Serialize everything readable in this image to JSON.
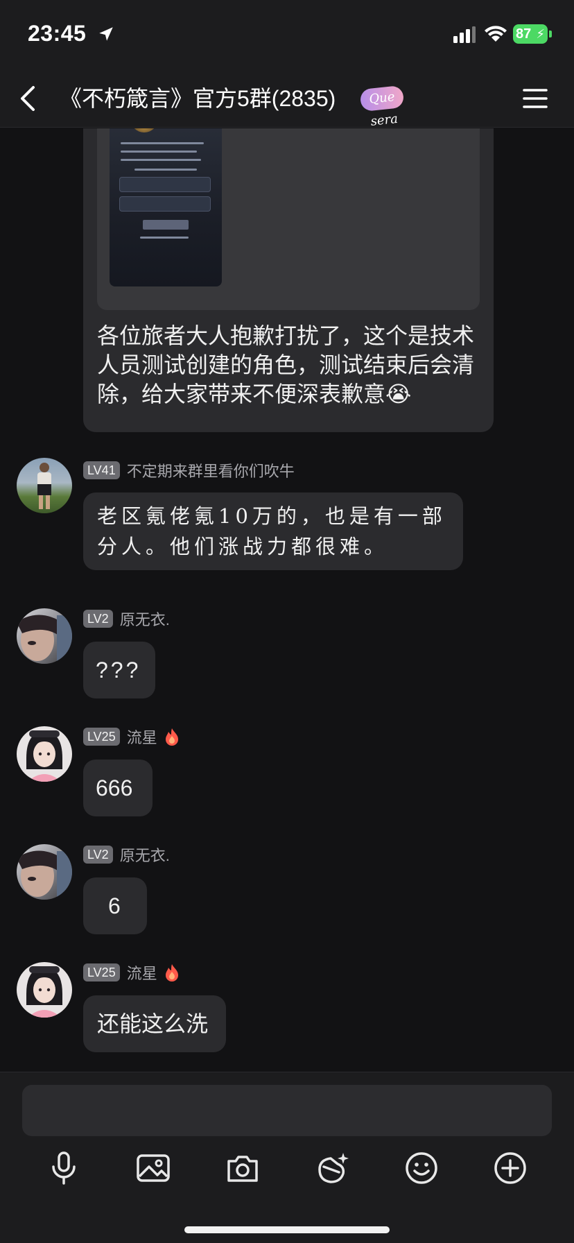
{
  "status_bar": {
    "time": "23:45",
    "battery": "87"
  },
  "header": {
    "title": "《不朽箴言》官方5群(2835)",
    "badge_text": "Que sera"
  },
  "system_message": {
    "text": "各位旅者大人抱歉打扰了，这个是技术人员测试创建的角色，测试结束后会清除，给大家带来不便深表歉意😭"
  },
  "messages": [
    {
      "level": "LV41",
      "nickname": "不定期来群里看你们吹牛",
      "text": "老区氪佬氪10万的，也是有一部分人。他们涨战力都很难。"
    },
    {
      "level": "LV2",
      "nickname": "原无衣.",
      "text": "???"
    },
    {
      "level": "LV25",
      "nickname": "流星",
      "text": "666"
    },
    {
      "level": "LV2",
      "nickname": "原无衣.",
      "text": "6"
    },
    {
      "level": "LV25",
      "nickname": "流星",
      "text": "还能这么洗"
    }
  ],
  "colors": {
    "background": "#121214",
    "bubble": "#2b2b2e",
    "level_badge": "#6b6b70",
    "battery": "#4cd964"
  },
  "toolbar_icons": [
    "microphone-icon",
    "image-icon",
    "camera-icon",
    "sticker-icon",
    "emoji-icon",
    "plus-icon"
  ]
}
